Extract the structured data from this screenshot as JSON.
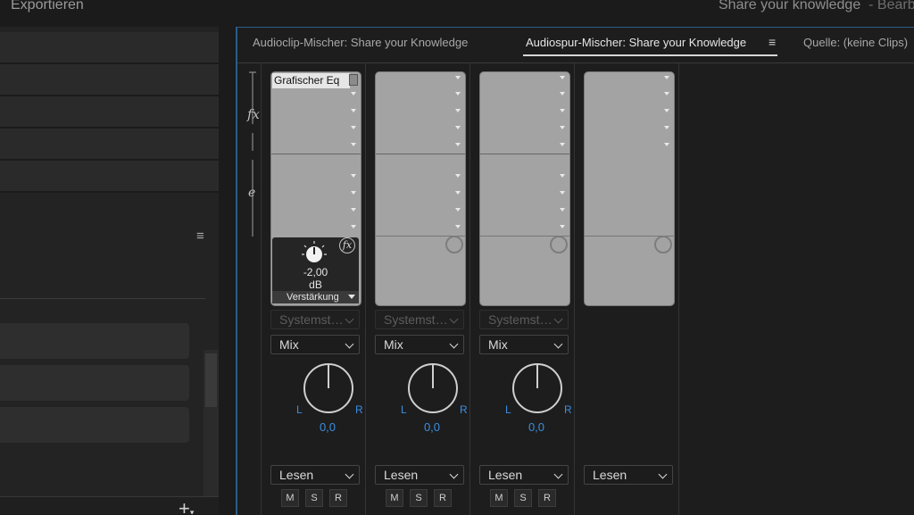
{
  "menu": {
    "export": "Exportieren"
  },
  "window": {
    "title": "Share your knowledge",
    "sep": "-",
    "suffix": "Bearb"
  },
  "tabs": [
    {
      "label": "Audioclip-Mischer: Share your Knowledge"
    },
    {
      "label": "Audiospur-Mischer: Share your Knowledge"
    },
    {
      "label": "Quelle: (keine Clips)"
    }
  ],
  "tab_menu_icon": "≡",
  "left_panel": {
    "menu_icon": "≡",
    "plus_icon": "+"
  },
  "side_labels": {
    "fx": "fx"
  },
  "channels": [
    {
      "effect": "Grafischer Eq",
      "knob_value": "-2,00",
      "knob_unit": "dB",
      "param": "Verstärkung",
      "send": "Systemst…",
      "mode": "Mix",
      "pan_L": "L",
      "pan_R": "R",
      "pan_value": "0,0",
      "automation": "Lesen",
      "m": "M",
      "s": "S",
      "r": "R"
    },
    {
      "send": "Systemst…",
      "mode": "Mix",
      "pan_L": "L",
      "pan_R": "R",
      "pan_value": "0,0",
      "automation": "Lesen",
      "m": "M",
      "s": "S",
      "r": "R"
    },
    {
      "send": "Systemst…",
      "mode": "Mix",
      "pan_L": "L",
      "pan_R": "R",
      "pan_value": "0,0",
      "automation": "Lesen",
      "m": "M",
      "s": "S",
      "r": "R"
    },
    {
      "automation": "Lesen"
    }
  ],
  "colors": {
    "accent_blue": "#3c8ee0",
    "panel_border": "#2d5d8a"
  }
}
